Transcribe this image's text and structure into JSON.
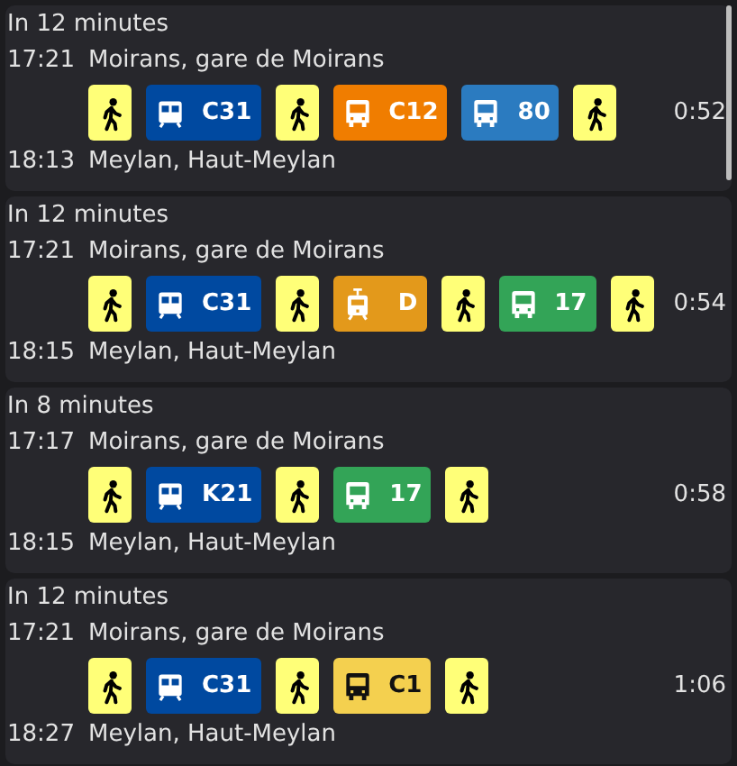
{
  "trips": [
    {
      "departs_in": "In 12 minutes",
      "departure": {
        "time": "17:21",
        "place": "Moirans, gare de Moirans"
      },
      "legs": [
        {
          "kind": "walk"
        },
        {
          "kind": "train",
          "line": "C31",
          "color": "#0049a0"
        },
        {
          "kind": "walk"
        },
        {
          "kind": "bus",
          "line": "C12",
          "color": "#f07d00"
        },
        {
          "kind": "bus",
          "line": "80",
          "color": "#2b7bc0"
        },
        {
          "kind": "walk"
        }
      ],
      "duration": "0:52",
      "arrival": {
        "time": "18:13",
        "place": "Meylan, Haut-Meylan"
      }
    },
    {
      "departs_in": "In 12 minutes",
      "departure": {
        "time": "17:21",
        "place": "Moirans, gare de Moirans"
      },
      "legs": [
        {
          "kind": "walk"
        },
        {
          "kind": "train",
          "line": "C31",
          "color": "#0049a0"
        },
        {
          "kind": "walk"
        },
        {
          "kind": "tram",
          "line": "D",
          "color": "#e3991b"
        },
        {
          "kind": "walk"
        },
        {
          "kind": "bus",
          "line": "17",
          "color": "#33a457"
        },
        {
          "kind": "walk"
        }
      ],
      "duration": "0:54",
      "arrival": {
        "time": "18:15",
        "place": "Meylan, Haut-Meylan"
      }
    },
    {
      "departs_in": "In 8 minutes",
      "departure": {
        "time": "17:17",
        "place": "Moirans, gare de Moirans"
      },
      "legs": [
        {
          "kind": "walk"
        },
        {
          "kind": "train",
          "line": "K21",
          "color": "#0049a0"
        },
        {
          "kind": "walk"
        },
        {
          "kind": "bus",
          "line": "17",
          "color": "#33a457"
        },
        {
          "kind": "walk"
        }
      ],
      "duration": "0:58",
      "arrival": {
        "time": "18:15",
        "place": "Meylan, Haut-Meylan"
      }
    },
    {
      "departs_in": "In 12 minutes",
      "departure": {
        "time": "17:21",
        "place": "Moirans, gare de Moirans"
      },
      "legs": [
        {
          "kind": "walk"
        },
        {
          "kind": "train",
          "line": "C31",
          "color": "#0049a0"
        },
        {
          "kind": "walk"
        },
        {
          "kind": "bus",
          "line": "C1",
          "color": "#f4d04f"
        },
        {
          "kind": "walk"
        }
      ],
      "duration": "1:06",
      "arrival": {
        "time": "18:27",
        "place": "Meylan, Haut-Meylan"
      }
    }
  ]
}
